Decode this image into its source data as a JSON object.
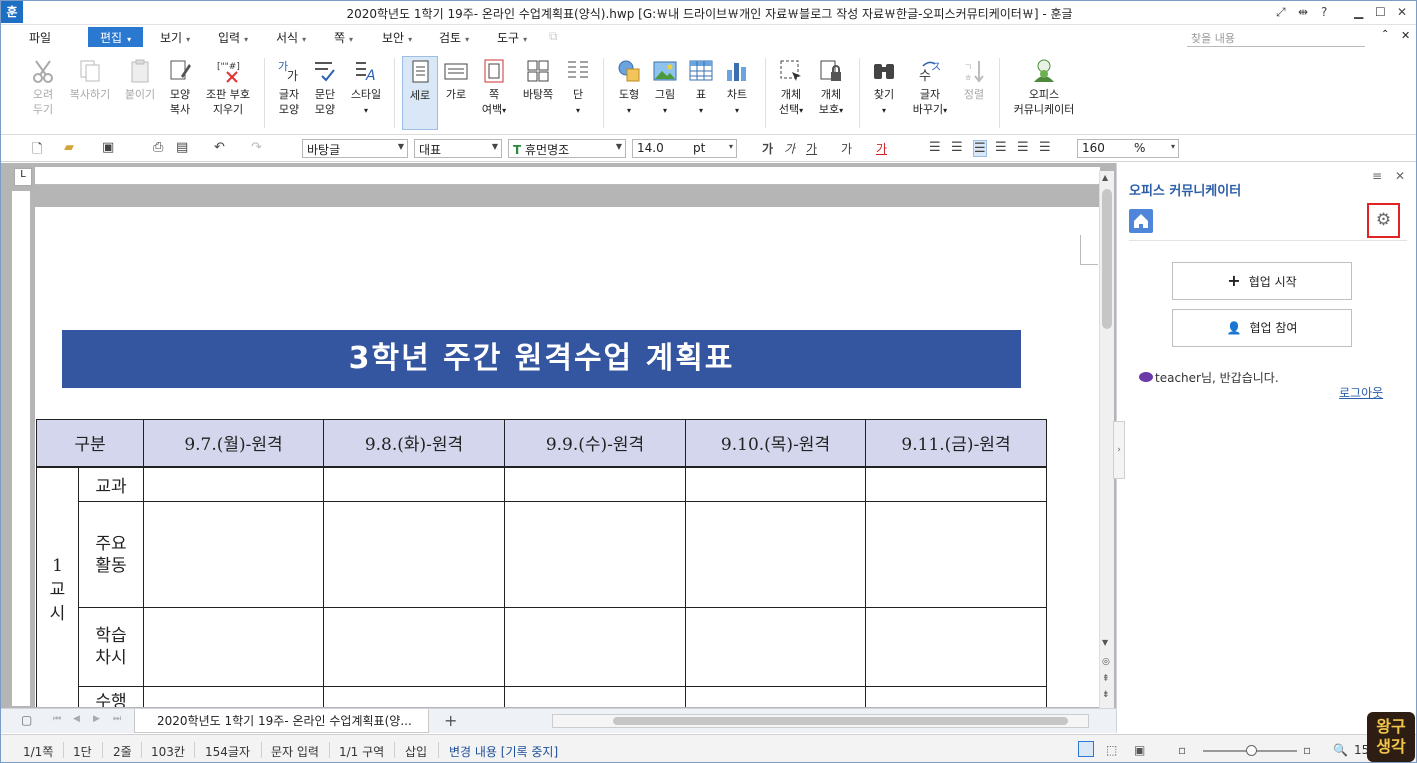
{
  "window": {
    "app_logo": "훈",
    "title": "2020학년도 1학기 19주- 온라인 수업계획표(양식).hwp [G:￦내 드라이브￦개인 자료￦블로그 작성 자료￦한글-오피스커뮤티케이터￦] - 훈글",
    "ctrl_help": "?"
  },
  "menu": {
    "file": "파일",
    "edit": "편집",
    "view": "보기",
    "input": "입력",
    "format": "서식",
    "page": "쪽",
    "security": "보안",
    "review": "검토",
    "tools": "도구",
    "search_placeholder": "찾을 내용"
  },
  "ribbon": {
    "cut": "오려\n두기",
    "copy": "복사하기",
    "paste": "붙이기",
    "format_copy": "모양\n복사",
    "clear_marks": "조판 부호\n지우기",
    "char_shape": "글자\n모양",
    "para_shape": "문단\n모양",
    "style": "스타일",
    "portrait": "세로",
    "landscape": "가로",
    "page_margin": "쪽\n여백",
    "master_page": "바탕쪽",
    "columns": "단",
    "shapes": "도형",
    "picture": "그림",
    "table": "표",
    "chart": "차트",
    "obj_select": "개체\n선택",
    "obj_protect": "개체\n보호",
    "find": "찾기",
    "replace": "글자\n바꾸기",
    "sort": "정렬",
    "office_comm": "오피스\n커뮤니케이터"
  },
  "format_bar": {
    "style_name": "바탕글",
    "font_lang": "대표",
    "font_name": "휴먼명조",
    "font_size": "14.0",
    "font_unit": "pt",
    "zoom": "160",
    "zoom_unit": "%"
  },
  "document": {
    "banner_title": "3학년 주간 원격수업 계획표",
    "headers": [
      "구분",
      "9.7.(월)-원격",
      "9.8.(화)-원격",
      "9.9.(수)-원격",
      "9.10.(목)-원격",
      "9.11.(금)-원격"
    ],
    "period_label": "1\n교\n시",
    "rows": [
      "교과",
      "주요\n활동",
      "학습\n차시",
      "수행"
    ]
  },
  "tabs": {
    "doc_tab": "2020학년도 1학기 19주- 온라인 수업계획표(양...",
    "add_tab": "+"
  },
  "side_panel": {
    "title": "오피스 커뮤니케이터",
    "start_collab": "협업 시작",
    "join_collab": "협업 참여",
    "greeting": "teacher님, 반갑습니다.",
    "logout": "로그아웃"
  },
  "status": {
    "page": "1/1쪽",
    "column": "1단",
    "line": "2줄",
    "col_pos": "103칸",
    "chars": "154글자",
    "input_mode": "문자 입력",
    "section": "1/1 구역",
    "insert": "삽입",
    "track": "변경 내용 [기록 중지]",
    "zoom_pct": "15"
  },
  "watermark": {
    "line1": "왕구",
    "line2": "생각"
  },
  "colors": {
    "accent": "#2b78d0",
    "banner": "#3455a0",
    "header_cell": "#d3d6ec",
    "highlight_box": "#e02424"
  }
}
